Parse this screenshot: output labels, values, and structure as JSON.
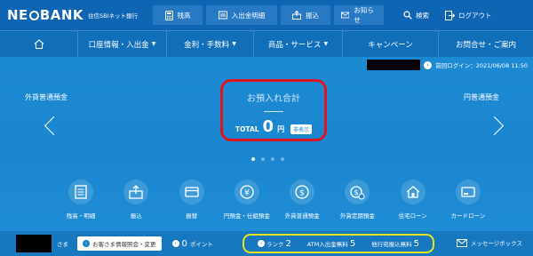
{
  "brand": {
    "logo": "NEOBANK",
    "sub": "住信SBIネット銀行"
  },
  "topnav": [
    {
      "label": "残高",
      "icon": "calculator-icon"
    },
    {
      "label": "入出金明細",
      "icon": "passbook-icon"
    },
    {
      "label": "振込",
      "icon": "transfer-icon"
    },
    {
      "label": "お知らせ",
      "icon": "mail-icon"
    }
  ],
  "toputil": {
    "search_label": "検索",
    "logout_label": "ログアウト"
  },
  "mainnav": [
    {
      "label": "",
      "icon": "home-icon"
    },
    {
      "label": "口座情報・入出金",
      "caret": "▼"
    },
    {
      "label": "金利・手数料",
      "caret": "▼"
    },
    {
      "label": "商品・サービス",
      "caret": "▼"
    },
    {
      "label": "キャンペーン"
    },
    {
      "label": "お問合せ・ご案内"
    }
  ],
  "login": {
    "text": "前回ログイン：2021/06/08 11:50"
  },
  "carousel": {
    "left_label": "外貨普通預金",
    "right_label": "円普通預金",
    "title": "お預入れ合計",
    "total_label": "TOTAL",
    "amount": "0",
    "unit": "円",
    "hide_button": "非表示",
    "dot_count": 4,
    "active_dot": 0
  },
  "quick": [
    {
      "label": "残高・明細",
      "icon": "passbook-icon"
    },
    {
      "label": "振込",
      "icon": "transfer-upload-icon"
    },
    {
      "label": "振替",
      "icon": "card-transfer-icon"
    },
    {
      "label": "円預金・仕組預金",
      "icon": "yen-coin-icon"
    },
    {
      "label": "外貨普通預金",
      "icon": "dollar-coin-icon"
    },
    {
      "label": "外貨定期預金",
      "icon": "dollar-clock-icon"
    },
    {
      "label": "住宅ローン",
      "icon": "house-icon"
    },
    {
      "label": "カードローン",
      "icon": "card-icon"
    }
  ],
  "footer": {
    "sama": "さま",
    "info_button": "お客さま情報照会・変更",
    "points_value": "0",
    "points_label": "ポイント",
    "rank_label": "ランク",
    "rank_value": "2",
    "atm_label": "ATM入出金無料",
    "atm_value": "5",
    "transfer_label": "他行宛振込無料",
    "transfer_value": "5",
    "message_box": "メッセージボックス"
  },
  "colors": {
    "header": "#0d65b3",
    "hero": "#1a86cf",
    "highlight_red": "#e0141e",
    "highlight_yellow": "#e4e619"
  }
}
